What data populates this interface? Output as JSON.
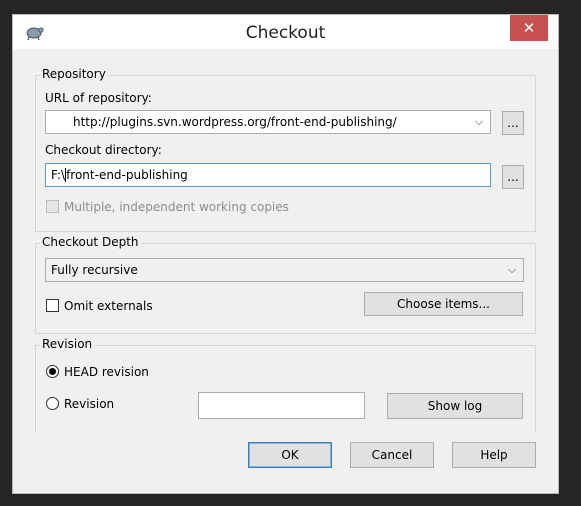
{
  "window": {
    "title": "Checkout",
    "close_glyph": "✕",
    "app_icon": "tortoise-icon"
  },
  "repository": {
    "group_label": "Repository",
    "url_label": "URL of repository:",
    "url_value": "http://plugins.svn.wordpress.org/front-end-publishing/",
    "url_browse": "...",
    "dir_label": "Checkout directory:",
    "dir_value_prefix": "F:\\",
    "dir_value_suffix": "front-end-publishing",
    "dir_browse": "...",
    "multiple_label": "Multiple, independent working copies"
  },
  "depth": {
    "group_label": "Checkout Depth",
    "depth_value": "Fully recursive",
    "omit_label": "Omit externals",
    "choose_items": "Choose items..."
  },
  "revision": {
    "group_label": "Revision",
    "head_label": "HEAD revision",
    "rev_label": "Revision",
    "rev_value": "",
    "show_log": "Show log"
  },
  "footer": {
    "ok": "OK",
    "cancel": "Cancel",
    "help": "Help"
  },
  "colors": {
    "close_button": "#c75050",
    "focus_border": "#5b9bd5",
    "window_bg": "#f0f0f0"
  }
}
